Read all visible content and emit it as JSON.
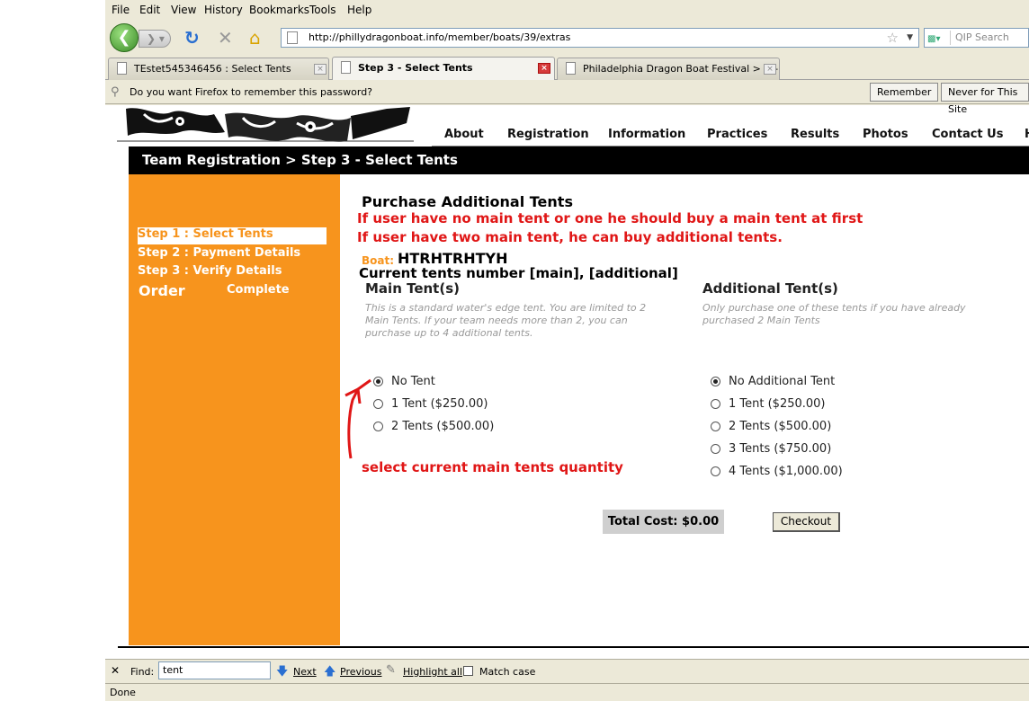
{
  "browser": {
    "menu": [
      "File",
      "Edit",
      "View",
      "History",
      "Bookmarks",
      "Tools",
      "Help"
    ],
    "url": "http://phillydragonboat.info/member/boats/39/extras",
    "search_placeholder": "QIP Search",
    "tabs": [
      {
        "title": "TEstet545346456 : Select Tents"
      },
      {
        "title": "Step 3 - Select Tents"
      },
      {
        "title": "Philadelphia Dragon Boat Festival > To-..."
      }
    ],
    "notification": {
      "text": "Do you want Firefox to remember this password?",
      "remember_label": "Remember",
      "never_label": "Never for This Site"
    },
    "findbar": {
      "find_label": "Find:",
      "find_value": "tent",
      "next_label": "Next",
      "previous_label": "Previous",
      "highlight_label": "Highlight all",
      "match_case_label": "Match case"
    },
    "status": "Done"
  },
  "site": {
    "nav": [
      "About",
      "Registration",
      "Information",
      "Practices",
      "Results",
      "Photos",
      "Contact Us",
      "H"
    ],
    "breadcrumb": "Team Registration > Step 3 - Select Tents",
    "steps": [
      {
        "label": "Step 1 : Select Tents",
        "active": true
      },
      {
        "label": "Step 2 : Payment Details",
        "active": false
      },
      {
        "label": "Step 3 : Verify Details",
        "active": false
      }
    ],
    "order_label": "Order",
    "complete_label": "Complete"
  },
  "content": {
    "heading": "Purchase Additional Tents",
    "annotation_1": "If user have no main tent or one he should buy a main tent at first",
    "annotation_2": "If user have two main tent, he can buy additional tents.",
    "boat_label": "Boat:",
    "boat_name": "HTRHTRHTYH",
    "tents_note": "Current tents number [main], [additional]",
    "main": {
      "title": "Main Tent(s)",
      "description": "This is a standard water's edge tent. You are limited to 2 Main Tents. If your team needs more than 2, you can purchase up to 4 additional tents.",
      "options": [
        "No Tent",
        "1 Tent ($250.00)",
        "2 Tents ($500.00)"
      ],
      "selected": 0
    },
    "additional": {
      "title": "Additional Tent(s)",
      "description": "Only purchase one of these tents if you have already purchased 2 Main Tents",
      "options": [
        "No Additional Tent",
        "1 Tent ($250.00)",
        "2 Tents ($500.00)",
        "3 Tents ($750.00)",
        "4 Tents ($1,000.00)"
      ],
      "selected": 0
    },
    "arrow_annotation": "select current main tents quantity",
    "total_cost": "Total Cost: $0.00",
    "checkout_label": "Checkout"
  },
  "colors": {
    "accent_orange": "#f7941d",
    "annotation_red": "#e01616"
  }
}
